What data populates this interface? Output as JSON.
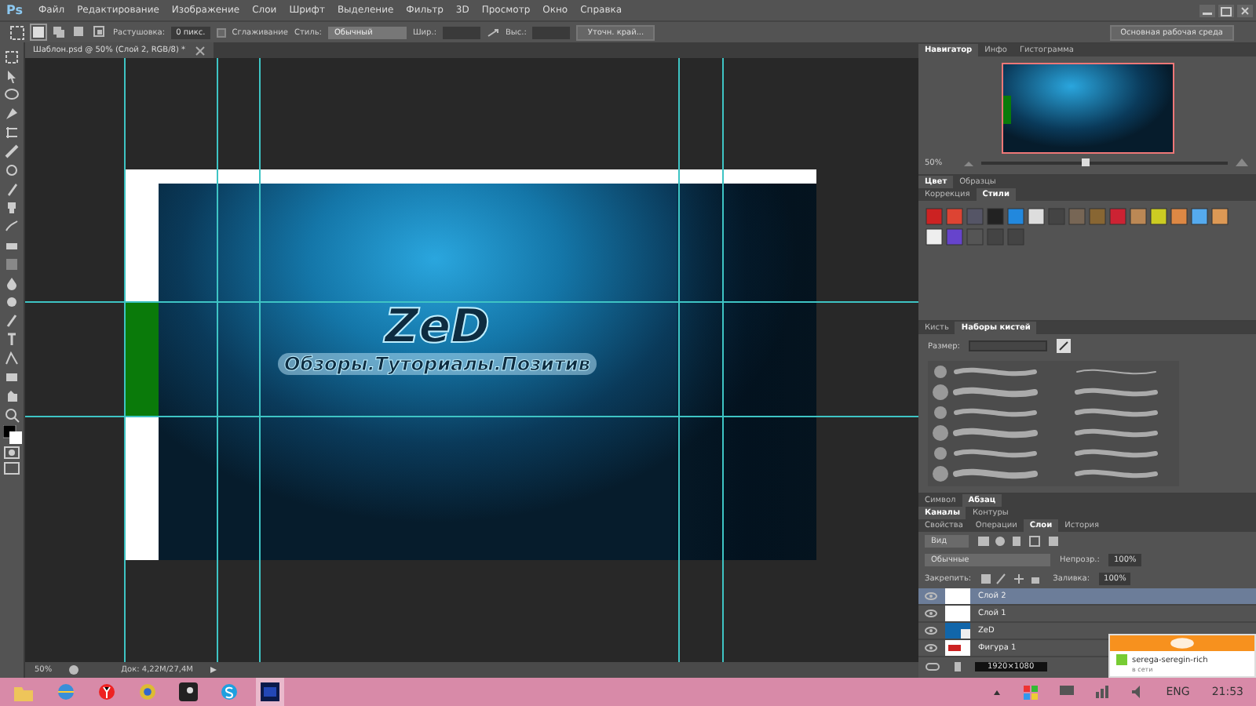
{
  "app": {
    "logo": "Ps",
    "menu": [
      "Файл",
      "Редактирование",
      "Изображение",
      "Слои",
      "Шрифт",
      "Выделение",
      "Фильтр",
      "3D",
      "Просмотр",
      "Окно",
      "Справка"
    ]
  },
  "options_bar": {
    "feather_label": "Растушовка:",
    "feather_value": "0 пикс.",
    "antialias": {
      "label": "Сглаживание",
      "checked": false
    },
    "style_label": "Стиль:",
    "style_value": "Обычный",
    "width_label": "Шир.:",
    "height_label": "Выс.:",
    "refine_button": "Уточн. край...",
    "workspace_button": "Основная рабочая среда"
  },
  "document": {
    "tab": "Шаблон.psd @ 50% (Слой 2, RGB/8) *",
    "title": "ZeD",
    "subtitle": "Обзоры.Туториалы.Позитив",
    "status_zoom": "50%",
    "status_doc": "Док: 4,22M/27,4M"
  },
  "navigator": {
    "tabs": [
      {
        "label": "Навигатор",
        "selected": true
      },
      {
        "label": "Инфо",
        "selected": false
      },
      {
        "label": "Гистограмма",
        "selected": false
      }
    ],
    "zoom": "50%",
    "zoom_slider": {
      "level": 0.42
    }
  },
  "color_tabs": [
    {
      "label": "Цвет",
      "selected": true
    },
    {
      "label": "Образцы",
      "selected": false
    }
  ],
  "styles_tabs": [
    {
      "label": "Коррекция",
      "selected": false
    },
    {
      "label": "Стили",
      "selected": true
    }
  ],
  "brush_tabs": [
    {
      "label": "Кисть",
      "selected": false
    },
    {
      "label": "Наборы кистей",
      "selected": true
    }
  ],
  "brush_size_label": "Размер:",
  "type_tabs": [
    {
      "label": "Символ",
      "selected": false
    },
    {
      "label": "Абзац",
      "selected": true
    }
  ],
  "channel_tabs": [
    {
      "label": "Каналы",
      "selected": true
    },
    {
      "label": "Контуры",
      "selected": false
    }
  ],
  "layer_tabs": [
    {
      "label": "Свойства",
      "selected": false
    },
    {
      "label": "Операции",
      "selected": false
    },
    {
      "label": "Слои",
      "selected": true
    },
    {
      "label": "История",
      "selected": false
    }
  ],
  "layers_panel": {
    "filter": "Вид",
    "blend_mode": "Обычные",
    "opacity_label": "Непрозр.:",
    "opacity": "100%",
    "lock_label": "Закрепить:",
    "fill_label": "Заливка:",
    "fill": "100%",
    "layers": [
      {
        "name": "Слой 2",
        "kind": "white",
        "selected": true
      },
      {
        "name": "Слой 1",
        "kind": "white",
        "selected": false
      },
      {
        "name": "ZeD",
        "kind": "text",
        "selected": false
      },
      {
        "name": "Фигура 1",
        "kind": "shape",
        "selected": false
      }
    ]
  },
  "size_readout": "1920×1080",
  "notification": {
    "contact": "serega-seregin-rich",
    "status": "в сети"
  },
  "taskbar": {
    "language": "ENG",
    "time": "21:53"
  }
}
